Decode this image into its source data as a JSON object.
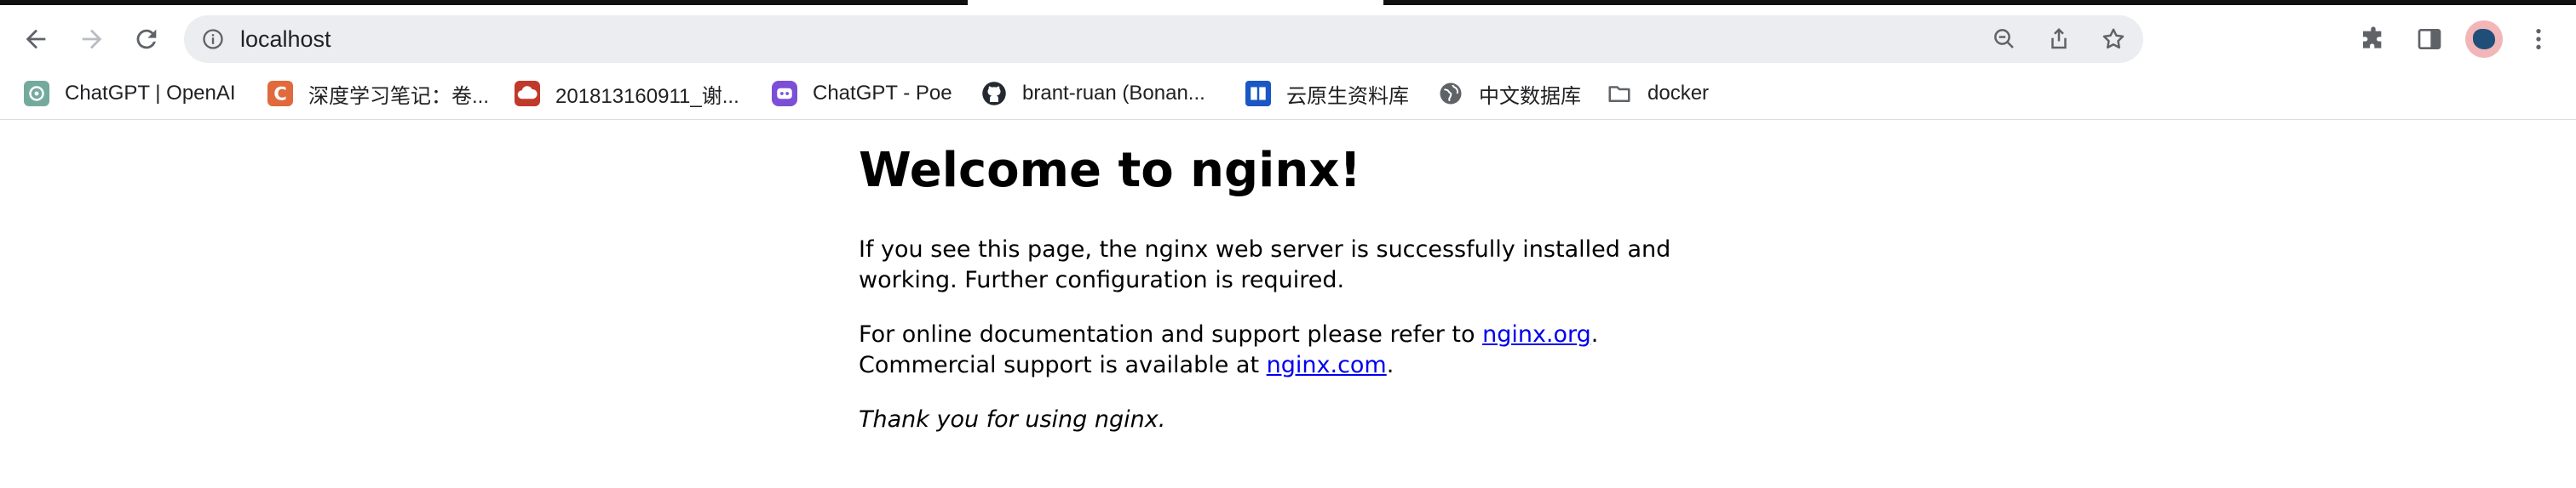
{
  "browser": {
    "url": "localhost",
    "bookmarks": [
      {
        "label": "ChatGPT | OpenAI",
        "icon": "openai-icon",
        "color": "#74aa9c"
      },
      {
        "label": "深度学习笔记：卷...",
        "icon": "c-logo-icon",
        "color": "#e06a3b"
      },
      {
        "label": "201813160911_谢...",
        "icon": "cloud-drive-icon",
        "color": "#c0392b"
      },
      {
        "label": "ChatGPT - Poe",
        "icon": "poe-icon",
        "color": "#7b4fd6"
      },
      {
        "label": "brant-ruan (Bonan...",
        "icon": "github-icon",
        "color": "#24292f"
      },
      {
        "label": "云原生资料库",
        "icon": "book-icon",
        "color": "#1a56c4"
      },
      {
        "label": "中文数据库",
        "icon": "globe-icon",
        "color": "#5f6368"
      },
      {
        "label": "docker",
        "icon": "folder-icon",
        "color": "#5f6368"
      }
    ]
  },
  "page": {
    "title": "Welcome to nginx!",
    "para1": "If you see this page, the nginx web server is successfully installed and working. Further configuration is required.",
    "para2_prefix": "For online documentation and support please refer to ",
    "link1": "nginx.org",
    "para2_mid": ".",
    "para2_line2_prefix": "Commercial support is available at ",
    "link2": "nginx.com",
    "para2_end": ".",
    "thanks": "Thank you for using nginx."
  }
}
